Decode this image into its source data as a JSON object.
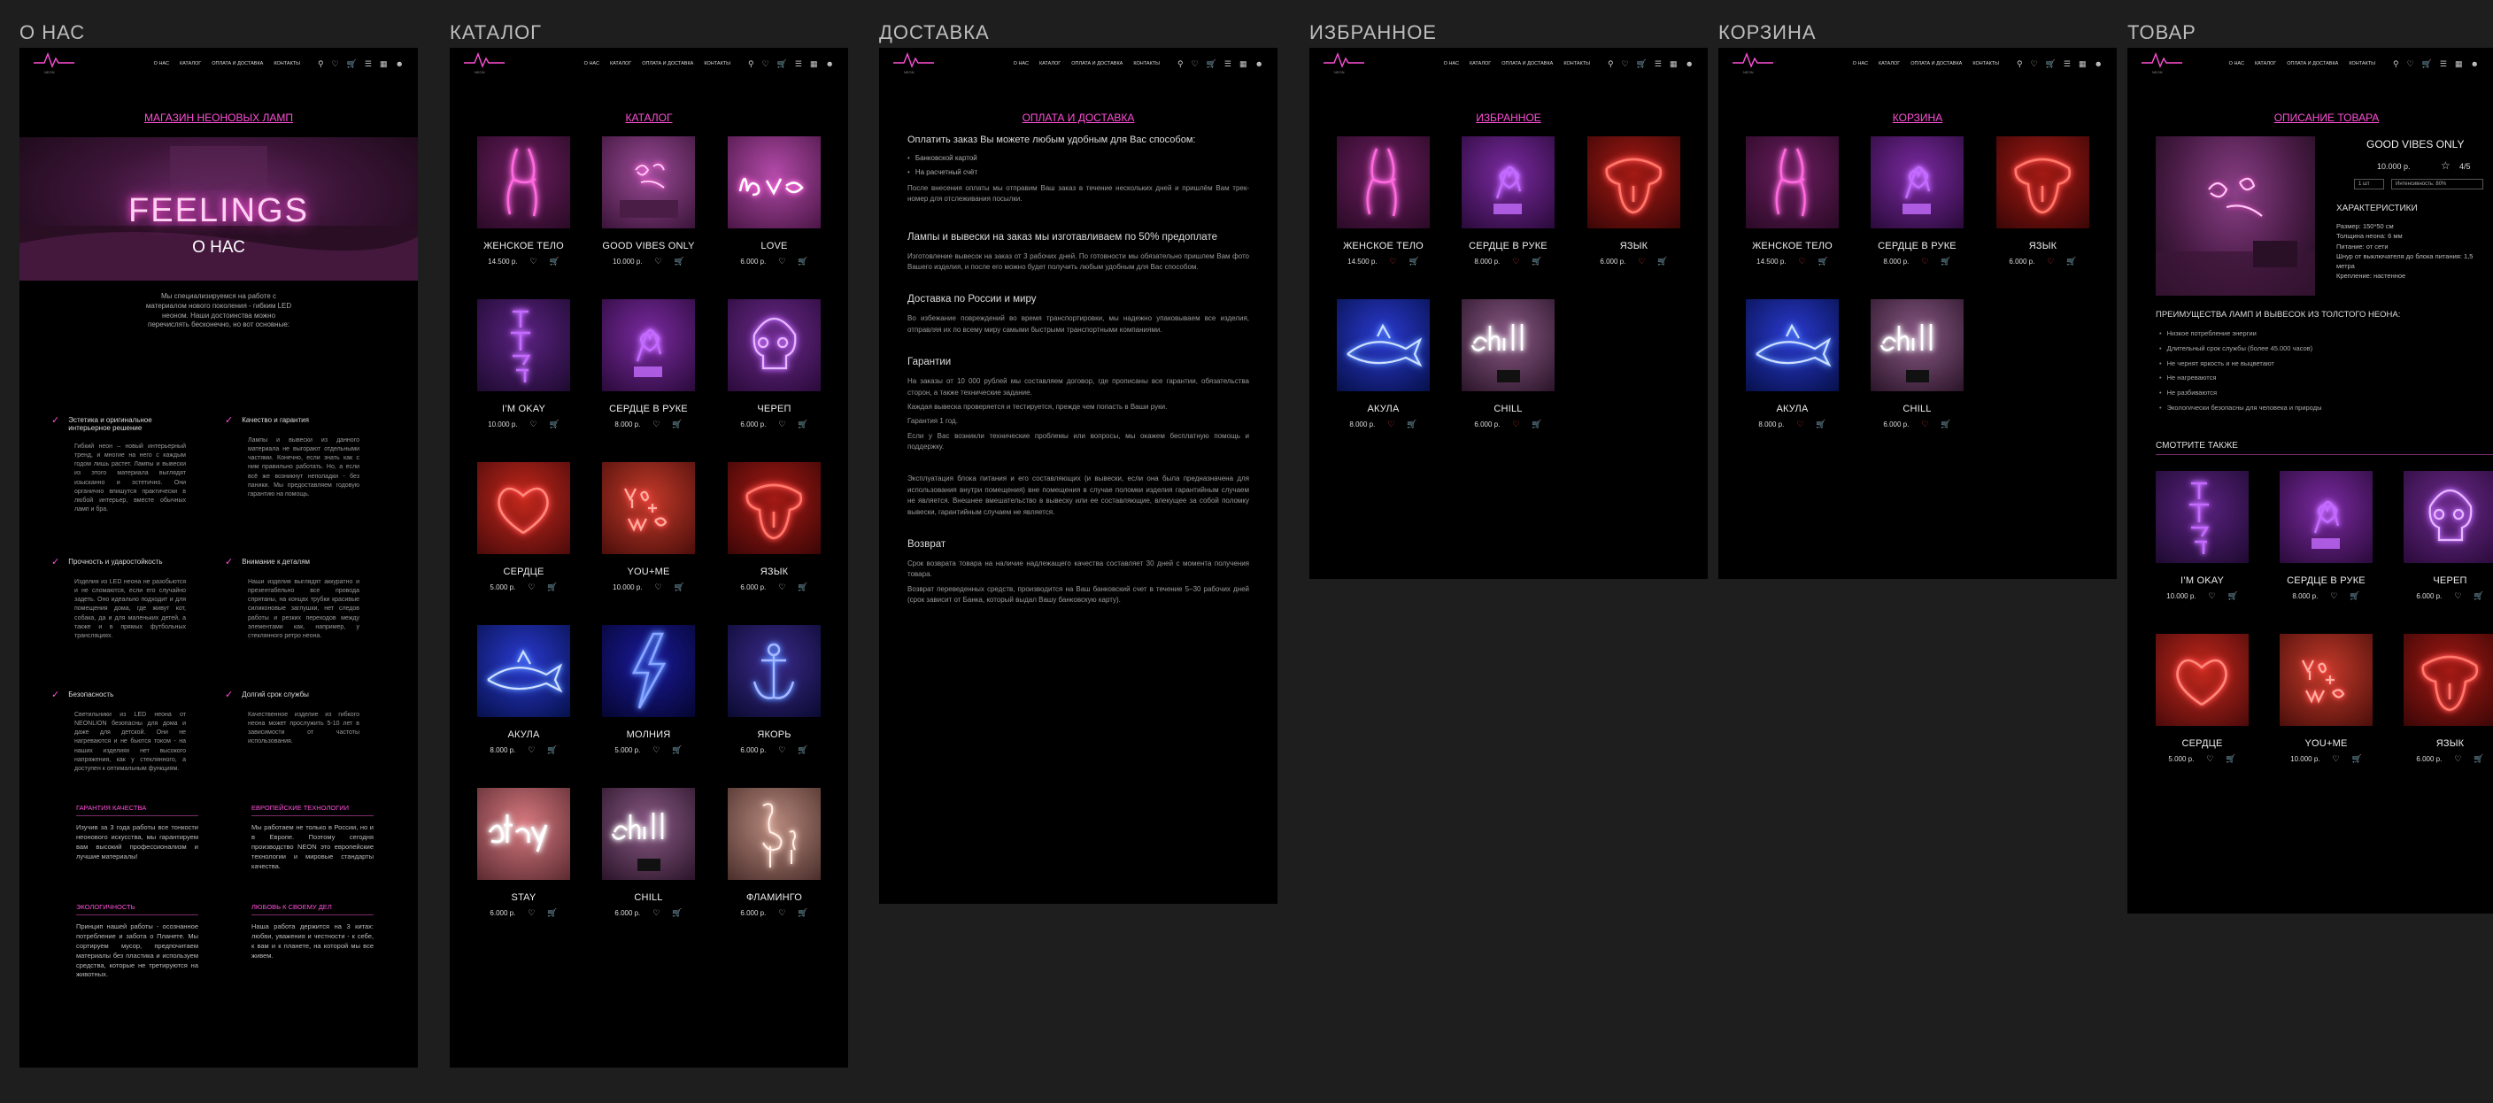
{
  "nav": {
    "logo_text": "NEON",
    "menu": [
      "О НАС",
      "КАТАЛОГ",
      "ОПЛАТА И ДОСТАВКА",
      "КОНТАКТЫ"
    ],
    "icons": [
      "search-icon",
      "heart-icon",
      "cart-icon",
      "compare-icon",
      "bag-icon",
      "user-icon"
    ]
  },
  "frames": {
    "about": {
      "label": "О НАС"
    },
    "catalog": {
      "label": "КАТАЛОГ"
    },
    "delivery": {
      "label": "ДОСТАВКА"
    },
    "favorites": {
      "label": "ИЗБРАННОЕ"
    },
    "cart": {
      "label": "КОРЗИНА"
    },
    "product": {
      "label": "ТОВАР"
    }
  },
  "about": {
    "page_title": "МАГАЗИН НЕОНОВЫХ ЛАМП",
    "hero_word": "FEELINGS",
    "hero_sub": "О НАС",
    "intro": "Мы специализируемся на работе с материалом нового поколения - гибким LED неоном. Наши достоинства можно перечислять бесконечно, но вот основные:",
    "features": [
      {
        "title": "Эстетика и оригинальное интерьерное решение",
        "text": "Гибкий неон – новый интерьерный тренд, и многие на него с каждым годом лишь растет. Лампы и вывески из этого материала выглядят изысканно и эстетично. Они органично впишутся практически в любой интерьер, вместе обычных ламп и бра."
      },
      {
        "title": "Качество и гарантия",
        "text": "Лампы и вывески из данного материала не выгорают отдельными частями. Конечно, если знать как с ним правильно работать. Но, а если всё же возникнут неполадки - без паники. Мы предоставляем годовую гарантию на помощь."
      },
      {
        "title": "Прочность и ударостойкость",
        "text": "Изделия из LED неона не разобьются и не сломаются, если его случайно задеть. Оно идеально подходит и для помещения дома, где живут кот, собака, да и для маленьких детей, а также и в прямых футбольных трансляциях."
      },
      {
        "title": "Внимание к деталям",
        "text": "Наши изделия выглядят аккуратно и презентабельно все провода спрятаны, на концах трубки красивые силиконовые заглушки, нет следов работы и резких переходов между элементами как, например, у стеклянного ретро неона."
      },
      {
        "title": "Безопасность",
        "text": "Светильники из LED неона от NEONLION безопасны для дома и даже для детской. Они не нагреваются и не бьются током - на наших изделиях нет высокого напряжения, как у стеклянного, а доступен к оптимальным функциям."
      },
      {
        "title": "Долгий срок службы",
        "text": "Качественное изделие из гибкого неона может прослужить 5-10 лет в зависимости от частоты использования."
      }
    ],
    "blocks": [
      {
        "title": "ГАРАНТИЯ КАЧЕСТВА",
        "text": "Изучив за 3 года работы все тонкости неонового искусства, мы гарантируем вам высокий профессионализм и лучшие материалы!"
      },
      {
        "title": "ЕВРОПЕЙСКИЕ ТЕХНОЛОГИИ",
        "text": "Мы работаем не только в России, но и в Европе. Поэтому сегодня производство NEON это европейские технологии и мировые стандарты качества."
      },
      {
        "title": "ЭКОЛОГИЧНОСТЬ",
        "text": "Принцип нашей работы - осознанное потребление и забота о Планете. Мы сортируем мусор, предпочитаем материалы без пластика и используем средства, которые не третируются на животных."
      },
      {
        "title": "ЛЮБОВЬ К СВОЕМУ ДЕЛ",
        "text": "Наша работа держится на 3 китах: любви, уважения и честности - к себе, к вам и к планете, на которой мы все живем."
      }
    ]
  },
  "catalog": {
    "page_title": "КАТАЛОГ",
    "items": [
      {
        "name": "ЖЕНСКОЕ ТЕЛО",
        "price": "14.500 р."
      },
      {
        "name": "GOOD VIBES ONLY",
        "price": "10.000 р."
      },
      {
        "name": "lOVE",
        "price": "6.000 р."
      },
      {
        "name": "I’M OKAY",
        "price": "10.000 р."
      },
      {
        "name": "СЕРДЦЕ В РУКЕ",
        "price": "8.000 р."
      },
      {
        "name": "ЧЕРЕП",
        "price": "6.000 р."
      },
      {
        "name": "СЕРДЦЕ",
        "price": "5.000 р."
      },
      {
        "name": "YOU+ME",
        "price": "10.000 р."
      },
      {
        "name": "ЯЗЫК",
        "price": "6.000 р."
      },
      {
        "name": "АКУЛА",
        "price": "8.000 р."
      },
      {
        "name": "МОЛНИЯ",
        "price": "5.000 р."
      },
      {
        "name": "ЯКОРЬ",
        "price": "6.000 р."
      },
      {
        "name": "STAY",
        "price": "6.000 р."
      },
      {
        "name": "CHILL",
        "price": "6.000 р."
      },
      {
        "name": "ФЛАМИНГО",
        "price": "6.000 р."
      }
    ]
  },
  "delivery": {
    "page_title": "ОПЛАТА И ДОСТАВКА",
    "pay_title": "Оплатить заказ Вы можете любым удобным для Вас способом:",
    "pay_options": [
      "Банковской картой",
      "На расчетный счёт"
    ],
    "pay_text": "После внесения оплаты мы отправим Ваш заказ в течение нескольких дней и пришлём Вам трек-номер для отслеживания посылки.",
    "sections": [
      {
        "title": "Лампы и вывески на заказ мы изготавливаем по 50% предоплате",
        "paras": [
          "Изготовление вывесок на заказ от 3 рабочих дней. По готовности мы обязательно пришлем Вам фото Вашего изделия, и после его можно будет получить любым удобным для Вас способом."
        ]
      },
      {
        "title": "Доставка по России и миру",
        "paras": [
          "Во избежание повреждений во время транспортировки, мы надежно упаковываем все изделия, отправляя их по всему миру самыми быстрыми транспортными компаниями."
        ]
      },
      {
        "title": "Гарантии",
        "paras": [
          "На заказы от 10 000 рублей мы составляем договор, где прописаны все гарантии, обязательства сторон, а также технические задание.",
          "Каждая вывеска проверяется и тестируется, прежде чем попасть в Ваши руки.",
          "Гарантия 1 год.",
          "Если у Вас возникли технические проблемы или вопросы, мы окажем бесплатную помощь и поддержку.",
          "Эксплуатация блока питания и его составляющих (и вывески, если она была предназначена для использования внутри помещения) вне помещения в случае поломки изделия гарантийным случаем не является. Внешнее вмешательство в вывеску или ее составляющие, влекущее за собой поломку вывески, гарантийным случаем не является."
        ]
      },
      {
        "title": "Возврат",
        "paras": [
          "Срок возврата товара на наличие надлежащего качества составляет 30 дней с момента получения товара.",
          "Возврат переведенных средств, производится на Ваш банковский счет в течение 5–30 рабочих дней (срок зависит от Банка, который выдал Вашу банковскую карту)."
        ]
      }
    ]
  },
  "favorites": {
    "page_title": "ИЗБРАННОЕ",
    "items": [
      {
        "name": "ЖЕНСКОЕ ТЕЛО",
        "price": "14.500 р."
      },
      {
        "name": "СЕРДЦЕ В РУКЕ",
        "price": "8.000 р."
      },
      {
        "name": "ЯЗЫК",
        "price": "6.000 р."
      },
      {
        "name": "АКУЛА",
        "price": "8.000 р."
      },
      {
        "name": "CHILL",
        "price": "6.000 р."
      }
    ]
  },
  "cart": {
    "page_title": "КОРЗИНА",
    "items": [
      {
        "name": "ЖЕНСКОЕ ТЕЛО",
        "price": "14.500 р."
      },
      {
        "name": "СЕРДЦЕ В РУКЕ",
        "price": "8.000 р."
      },
      {
        "name": "ЯЗЫК",
        "price": "6.000 р."
      },
      {
        "name": "АКУЛА",
        "price": "8.000 р."
      },
      {
        "name": "CHILL",
        "price": "6.000 р."
      }
    ]
  },
  "product": {
    "page_title": "ОПИСАНИЕ ТОВАРА",
    "name": "GOOD VIBES ONLY",
    "price": "10.000 р.",
    "rating": "4/5",
    "qty": "1 шт",
    "action": "Интенсивность: 80%",
    "char_title": "ХАРАКТЕРИСТИКИ",
    "chars": [
      "Размер: 150*50 см",
      "Толщина неона: 6 мм",
      "Питание: от сети",
      "Шнур от выключателя до блока питания: 1,5 метра",
      "Крепление: настенное"
    ],
    "adv_title": "ПРЕИМУЩЕСТВА ЛАМП И ВЫВЕСОК ИЗ ТОЛСТОГО НЕОНА:",
    "advantages": [
      "Низкое потребление энергии",
      "Длительный срок службы (более 45.000 часов)",
      "Не чернят яркость и не выцветают",
      "Не нагреваются",
      "Не разбиваются",
      "Экологически безопасны для человека и природы"
    ],
    "see_also": "СМОТРИТЕ ТАКЖЕ",
    "related": [
      {
        "name": "I’M OKAY",
        "price": "10.000 р."
      },
      {
        "name": "СЕРДЦЕ В РУКЕ",
        "price": "8.000 р."
      },
      {
        "name": "ЧЕРЕП",
        "price": "6.000 р."
      },
      {
        "name": "СЕРДЦЕ",
        "price": "5.000 р."
      },
      {
        "name": "YOU+ME",
        "price": "10.000 р."
      },
      {
        "name": "ЯЗЫК",
        "price": "6.000 р."
      }
    ]
  }
}
